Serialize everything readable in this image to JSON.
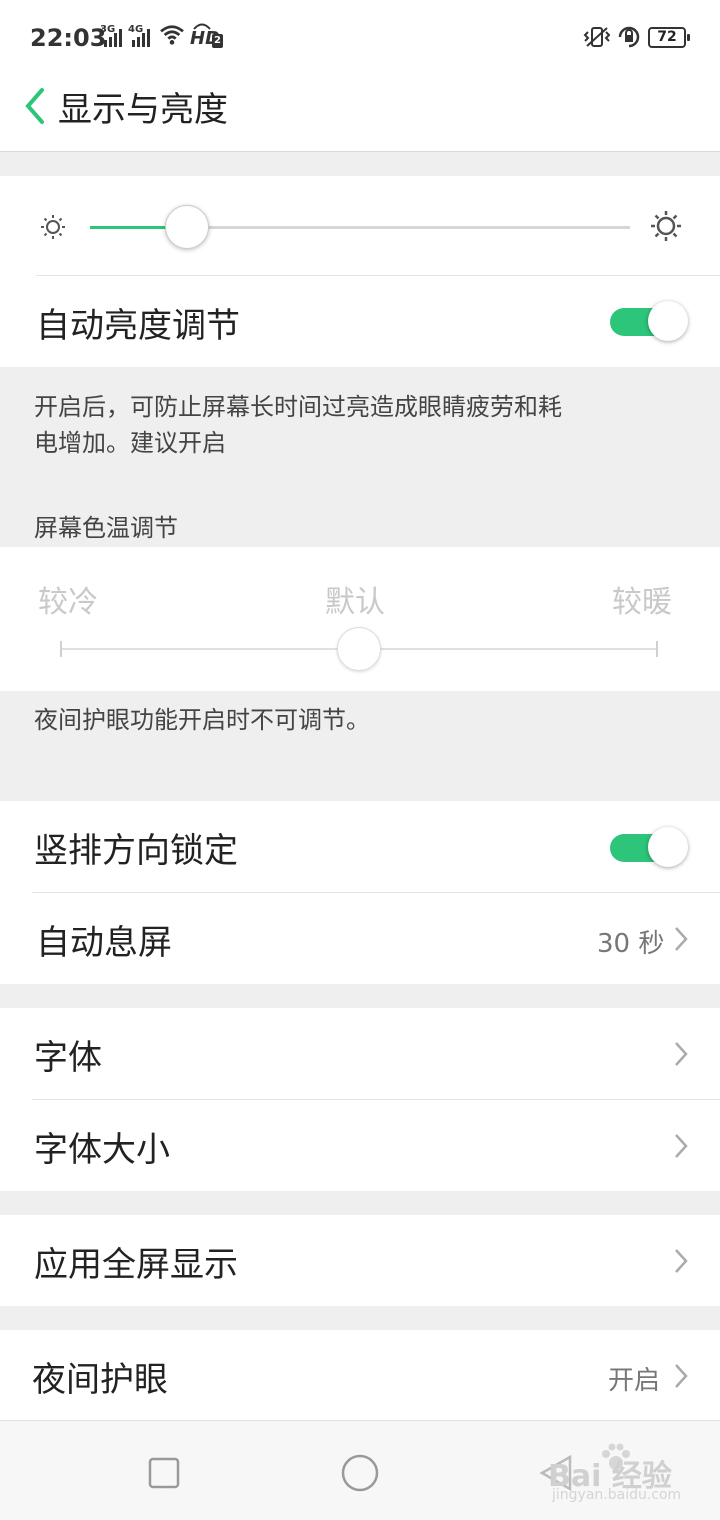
{
  "status_bar": {
    "time": "22:03",
    "net1": "3G",
    "net2": "4G",
    "hd_label": "HD",
    "hd_number": "2",
    "battery": "72"
  },
  "header": {
    "title": "显示与亮度"
  },
  "brightness": {
    "level_fraction": 0.18
  },
  "auto_brightness": {
    "label": "自动亮度调节",
    "enabled": true,
    "note_line1": "开启后，可防止屏幕长时间过亮造成眼睛疲劳和耗",
    "note_line2": "电增加。建议开启"
  },
  "color_temp": {
    "section_label": "屏幕色温调节",
    "cold": "较冷",
    "default": "默认",
    "warm": "较暖",
    "level_fraction": 0.5,
    "note": "夜间护眼功能开启时不可调节。"
  },
  "settings": {
    "portrait_lock": {
      "label": "竖排方向锁定",
      "enabled": true
    },
    "auto_sleep": {
      "label": "自动息屏",
      "value": "30 秒"
    },
    "font": {
      "label": "字体"
    },
    "font_size": {
      "label": "字体大小"
    },
    "app_fullscreen": {
      "label": "应用全屏显示"
    },
    "night_mode": {
      "label": "夜间护眼",
      "value": "开启"
    }
  },
  "watermark": {
    "text": "Bai 经验",
    "url": "jingyan.baidu.com"
  },
  "colors": {
    "accent": "#2cc57a",
    "background": "#efefef",
    "card": "#ffffff"
  },
  "icons": [
    "back-chevron-icon",
    "brightness-low-icon",
    "brightness-high-icon",
    "chevron-right-icon",
    "vibrate-icon",
    "rotation-lock-icon",
    "wifi-icon",
    "signal-icon"
  ]
}
